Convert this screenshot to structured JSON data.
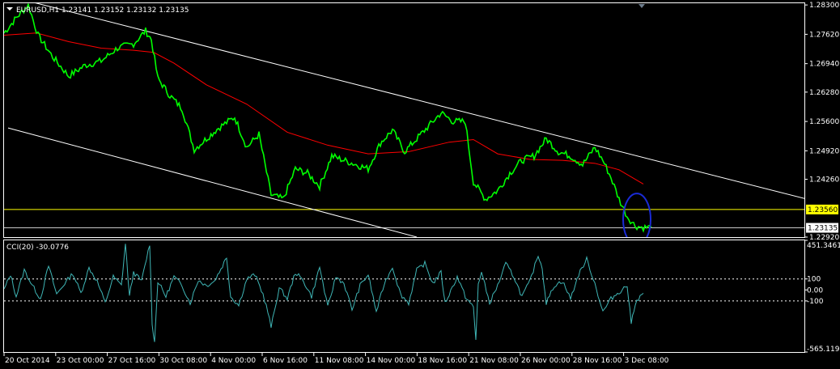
{
  "window": {
    "main_header": "EURUSD,H1  1.23141 1.23152 1.23132 1.23135",
    "indicator_header": "CCI(20) -30.0776"
  },
  "colors": {
    "background": "#000000",
    "price": "#00ff00",
    "ma": "#ff0000",
    "channel": "#ffffff",
    "support": "#ffff00",
    "cci": "#3fb6b6",
    "circle": "#1a2bd6",
    "grid": "#ffffff"
  },
  "chart_data": [
    {
      "type": "line",
      "instrument": "EURUSD",
      "timeframe": "H1",
      "ohlc": {
        "open": 1.23141,
        "high": 1.23152,
        "low": 1.23132,
        "close": 1.23135
      },
      "ylim": [
        1.2292,
        1.2834
      ],
      "y_ticks": [
        "1.28300",
        "1.27620",
        "1.26940",
        "1.26280",
        "1.25600",
        "1.24920",
        "1.24260",
        "1.23560",
        "1.23135",
        "1.22920"
      ],
      "x_ticks": [
        "20 Oct 2014",
        "23 Oct 00:00",
        "27 Oct 16:00",
        "30 Oct 08:00",
        "4 Nov 00:00",
        "6 Nov 16:00",
        "11 Nov 08:00",
        "14 Nov 00:00",
        "18 Nov 16:00",
        "21 Nov 08:00",
        "26 Nov 00:00",
        "28 Nov 16:00",
        "3 Dec 08:00"
      ],
      "series": [
        {
          "kind": "price",
          "x": [
            0,
            15,
            30,
            42,
            60,
            80,
            100,
            120,
            140,
            160,
            175,
            182,
            190,
            205,
            220,
            235,
            250,
            265,
            285,
            300,
            315,
            330,
            345,
            360,
            375,
            390,
            405,
            420,
            435,
            450,
            465,
            480,
            495,
            510,
            525,
            540,
            555,
            570,
            580,
            595,
            610,
            625,
            640,
            655,
            670,
            685,
            700,
            715,
            730,
            740,
            750,
            760,
            770,
            780,
            790,
            800
          ],
          "y": [
            1.2765,
            1.28,
            1.283,
            1.276,
            1.271,
            1.2665,
            1.269,
            1.27,
            1.273,
            1.274,
            1.277,
            1.275,
            1.266,
            1.262,
            1.259,
            1.2495,
            1.252,
            1.2545,
            1.257,
            1.25,
            1.253,
            1.239,
            1.238,
            1.245,
            1.244,
            1.241,
            1.248,
            1.247,
            1.246,
            1.245,
            1.251,
            1.254,
            1.249,
            1.252,
            1.255,
            1.258,
            1.256,
            1.256,
            1.242,
            1.238,
            1.24,
            1.244,
            1.247,
            1.248,
            1.252,
            1.249,
            1.248,
            1.246,
            1.25,
            1.247,
            1.243,
            1.238,
            1.234,
            1.2318,
            1.2314,
            1.2315
          ]
        },
        {
          "kind": "moving-average",
          "x": [
            0,
            40,
            80,
            120,
            160,
            185,
            210,
            250,
            300,
            350,
            400,
            450,
            500,
            550,
            580,
            610,
            650,
            690,
            730,
            760,
            790
          ],
          "y": [
            1.276,
            1.2765,
            1.2745,
            1.273,
            1.2725,
            1.272,
            1.2695,
            1.2645,
            1.26,
            1.2535,
            1.2505,
            1.2485,
            1.249,
            1.2512,
            1.2518,
            1.2485,
            1.2472,
            1.247,
            1.2463,
            1.2448,
            1.2415
          ]
        }
      ],
      "channel_upper": {
        "x": [
          32,
          990
        ],
        "y": [
          1.2838,
          1.2381
        ]
      },
      "channel_lower": {
        "x": [
          5,
          510
        ],
        "y": [
          1.2545,
          1.2292
        ]
      },
      "support_level": 1.2356,
      "current_price": 1.23135,
      "highlight_circle": {
        "x": 782,
        "y": 1.2333
      }
    },
    {
      "type": "line",
      "indicator": "CCI(20)",
      "last_value": -30.0776,
      "ylim": [
        -565.1197,
        451.3461
      ],
      "y_ticks": [
        "451.3461",
        "100",
        "0.00",
        "-100",
        "-565.1197"
      ],
      "levels": [
        100,
        -100
      ],
      "x": [
        0,
        8,
        15,
        25,
        35,
        45,
        55,
        65,
        75,
        85,
        95,
        105,
        115,
        125,
        135,
        145,
        150,
        155,
        160,
        170,
        180,
        183,
        186,
        190,
        200,
        210,
        220,
        230,
        240,
        250,
        260,
        270,
        275,
        280,
        290,
        300,
        310,
        320,
        326,
        330,
        340,
        350,
        360,
        370,
        380,
        390,
        400,
        410,
        420,
        430,
        440,
        450,
        460,
        470,
        480,
        490,
        500,
        510,
        520,
        530,
        540,
        545,
        550,
        560,
        570,
        580,
        583,
        586,
        590,
        600,
        610,
        620,
        630,
        640,
        650,
        660,
        665,
        670,
        680,
        690,
        700,
        710,
        720,
        730,
        740,
        750,
        760,
        770,
        775,
        780,
        790
      ],
      "y": [
        0,
        140,
        -60,
        180,
        40,
        -80,
        220,
        -40,
        60,
        150,
        -30,
        200,
        80,
        -120,
        120,
        40,
        420,
        -60,
        160,
        80,
        420,
        -300,
        -480,
        80,
        -60,
        120,
        40,
        -120,
        90,
        40,
        80,
        220,
        300,
        -60,
        -140,
        100,
        140,
        -40,
        -200,
        -340,
        20,
        -80,
        160,
        80,
        -60,
        210,
        -160,
        120,
        60,
        -180,
        40,
        140,
        -200,
        60,
        210,
        -40,
        -120,
        180,
        240,
        60,
        160,
        -120,
        -40,
        120,
        -60,
        -160,
        -460,
        60,
        160,
        -120,
        40,
        240,
        120,
        -60,
        80,
        320,
        200,
        -120,
        40,
        80,
        -80,
        140,
        280,
        60,
        -200,
        -80,
        -20,
        40,
        -300,
        -120,
        -30
      ]
    }
  ]
}
